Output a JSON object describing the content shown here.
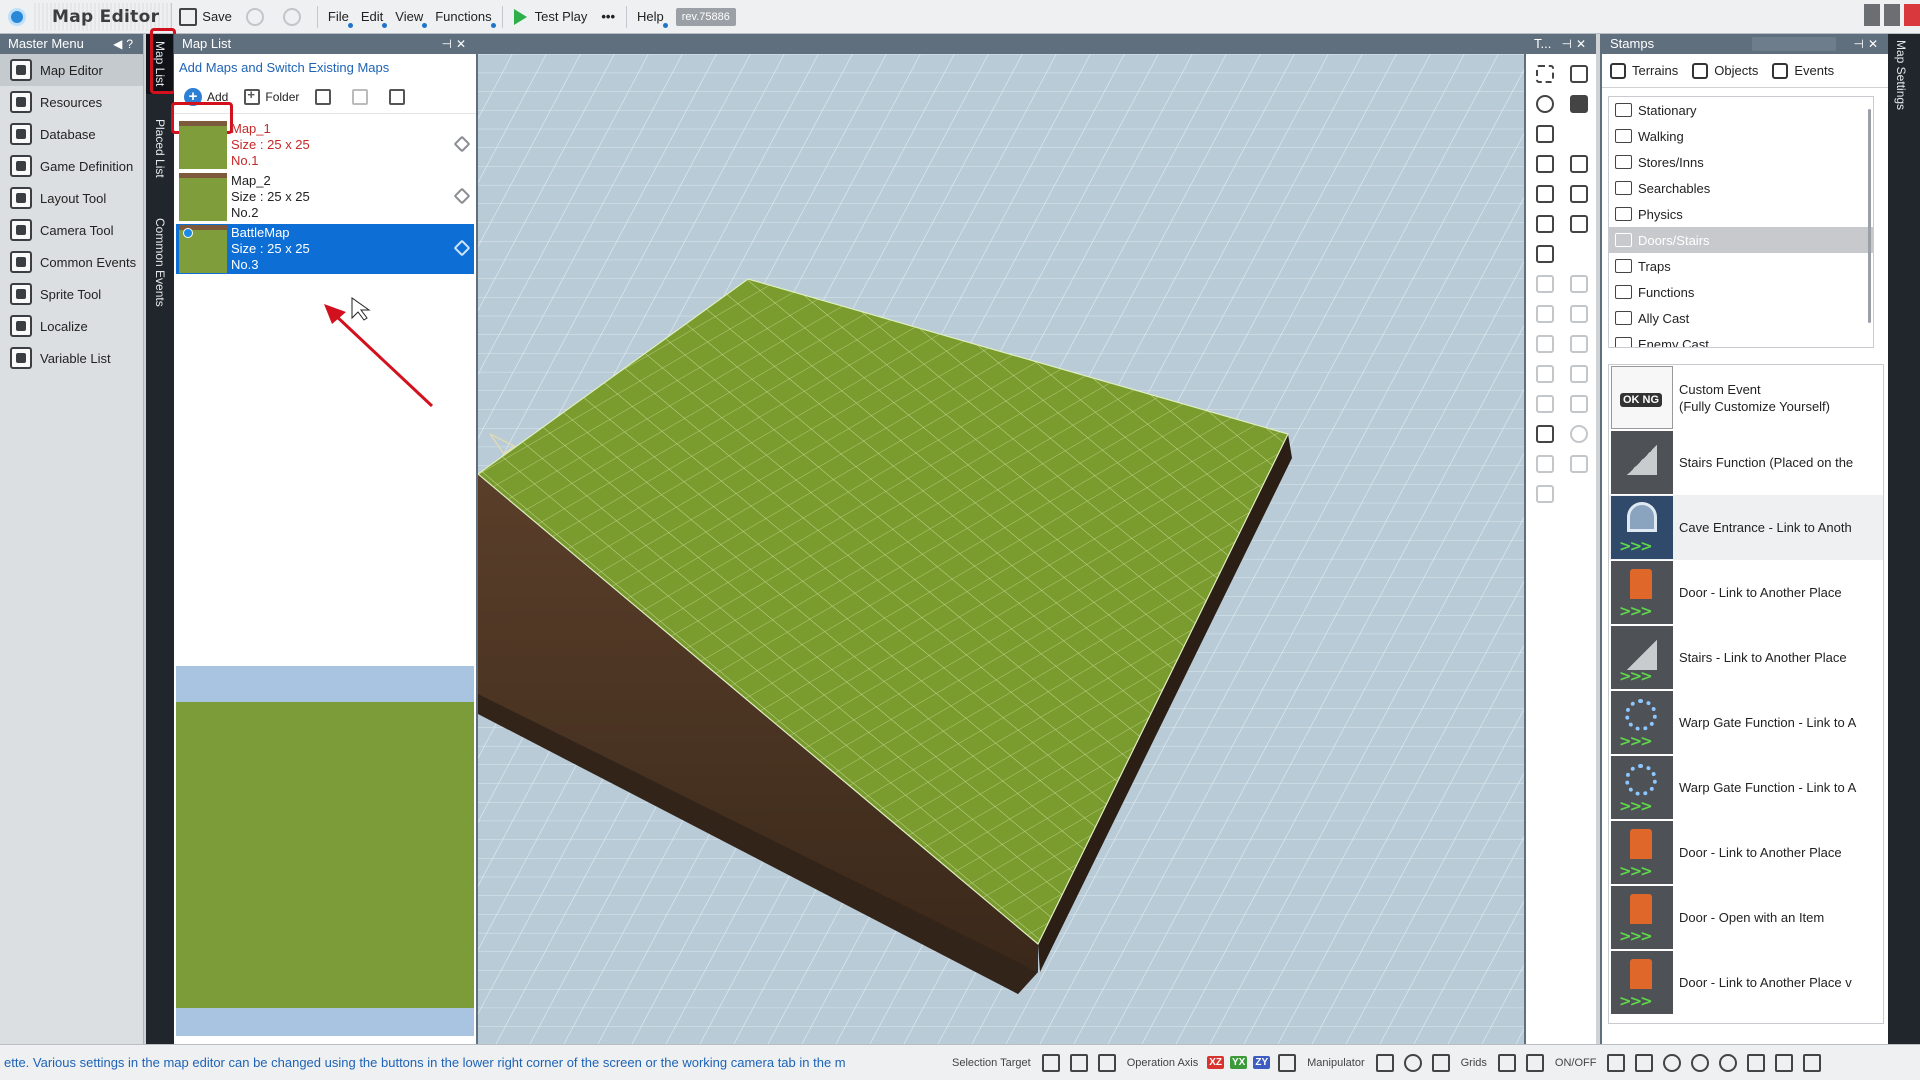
{
  "topbar": {
    "app_title": "Map Editor",
    "save_label": "Save",
    "menus": [
      "File",
      "Edit",
      "View",
      "Functions"
    ],
    "test_play_label": "Test Play",
    "more_label": "•••",
    "help_label": "Help",
    "revision": "rev.75886"
  },
  "master_menu": {
    "title": "Master Menu",
    "items": [
      {
        "label": "Map Editor",
        "icon": "map-editor-icon"
      },
      {
        "label": "Resources",
        "icon": "resources-icon"
      },
      {
        "label": "Database",
        "icon": "database-icon"
      },
      {
        "label": "Game Definition",
        "icon": "game-definition-icon"
      },
      {
        "label": "Layout Tool",
        "icon": "layout-tool-icon"
      },
      {
        "label": "Camera Tool",
        "icon": "camera-tool-icon"
      },
      {
        "label": "Common Events",
        "icon": "common-events-icon"
      },
      {
        "label": "Sprite Tool",
        "icon": "sprite-tool-icon"
      },
      {
        "label": "Localize",
        "icon": "localize-icon"
      },
      {
        "label": "Variable List",
        "icon": "variable-list-icon"
      }
    ]
  },
  "side_tabs": [
    "Map List",
    "Placed List",
    "Common Events"
  ],
  "map_list": {
    "title": "Map List",
    "subtitle": "Add Maps and Switch Existing Maps",
    "add_label": "Add",
    "folder_label": "Folder",
    "maps": [
      {
        "name": "Map_1",
        "size": "Size : 25 x 25",
        "number": "No.1"
      },
      {
        "name": "Map_2",
        "size": "Size : 25 x 25",
        "number": "No.2"
      },
      {
        "name": "BattleMap",
        "size": "Size : 25 x 25",
        "number": "No.3"
      }
    ]
  },
  "tools_panel": {
    "title": "T..."
  },
  "stamps": {
    "title": "Stamps",
    "search_placeholder": "",
    "tabs": [
      "Terrains",
      "Objects",
      "Events"
    ],
    "categories": [
      "Stationary",
      "Walking",
      "Stores/Inns",
      "Searchables",
      "Physics",
      "Doors/Stairs",
      "Traps",
      "Functions",
      "Ally Cast",
      "Enemy Cast"
    ],
    "selected_category": "Doors/Stairs",
    "items": [
      {
        "label": "Custom Event",
        "label2": "(Fully Customize Yourself)",
        "icon": "custom-event-icon"
      },
      {
        "label": "Stairs Function (Placed on the",
        "label2": "",
        "icon": "stairs-icon"
      },
      {
        "label": "Cave Entrance - Link to Anoth",
        "label2": "",
        "icon": "cave-entrance-icon"
      },
      {
        "label": "Door - Link to Another Place",
        "label2": "",
        "icon": "door-icon"
      },
      {
        "label": "Stairs - Link to Another Place",
        "label2": "",
        "icon": "stairs-icon"
      },
      {
        "label": "Warp Gate Function - Link to A",
        "label2": "",
        "icon": "warp-gate-icon"
      },
      {
        "label": "Warp Gate Function - Link to A",
        "label2": "",
        "icon": "warp-gate-icon"
      },
      {
        "label": "Door - Link to Another Place",
        "label2": "",
        "icon": "door-icon"
      },
      {
        "label": "Door - Open with an Item",
        "label2": "",
        "icon": "door-icon"
      },
      {
        "label": "Door - Link to Another Place v",
        "label2": "",
        "icon": "door-icon"
      }
    ]
  },
  "map_settings_tab": "Map Settings",
  "status_bar": {
    "message": "ette.  Various settings in the map editor can be changed using the buttons in the lower right corner of the screen or the working camera tab in the m",
    "selection_target": "Selection Target",
    "operation_axis": "Operation Axis",
    "axes": [
      "XZ",
      "YX",
      "ZY"
    ],
    "manipulator": "Manipulator",
    "grids": "Grids",
    "on_off": "ON/OFF"
  },
  "colors": {
    "panel_header": "#5f6f7e",
    "selection": "#0d6fd6",
    "annotation_red": "#d3101d",
    "grass": "#7a9c2e",
    "soil": "#4a3422",
    "sky_floor": "#b6cad6"
  }
}
